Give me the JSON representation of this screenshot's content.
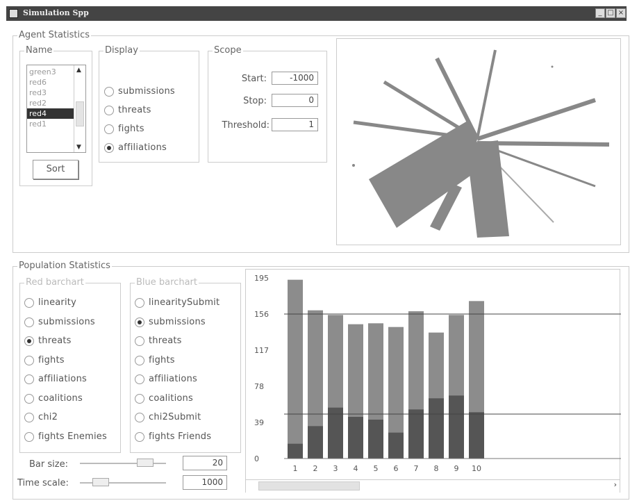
{
  "window": {
    "title": "Simulation Spp"
  },
  "agent_statistics": {
    "title": "Agent Statistics",
    "name_group": {
      "legend": "Name",
      "items": [
        "green3",
        "red6",
        "red3",
        "red2",
        "red4",
        "red1"
      ],
      "selected_index": 4,
      "sort_label": "Sort"
    },
    "display_group": {
      "legend": "Display",
      "options": [
        "submissions",
        "threats",
        "fights",
        "affiliations"
      ],
      "selected_index": 3
    },
    "scope_group": {
      "legend": "Scope",
      "start_label": "Start:",
      "start_value": "-1000",
      "stop_label": "Stop:",
      "stop_value": "0",
      "threshold_label": "Threshold:",
      "threshold_value": "1"
    }
  },
  "population_statistics": {
    "title": "Population Statistics",
    "red_barchart": {
      "legend": "Red barchart",
      "options": [
        "linearity",
        "submissions",
        "threats",
        "fights",
        "affiliations",
        "coalitions",
        "chi2",
        "fights Enemies"
      ],
      "selected_index": 2
    },
    "blue_barchart": {
      "legend": "Blue barchart",
      "options": [
        "linearitySubmit",
        "submissions",
        "threats",
        "fights",
        "affiliations",
        "coalitions",
        "chi2Submit",
        "fights Friends"
      ],
      "selected_index": 1
    },
    "bar_size": {
      "label": "Bar size:",
      "value": "20",
      "slider_fraction": 0.82
    },
    "time_scale": {
      "label": "Time scale:",
      "value": "1000",
      "slider_fraction": 0.18
    },
    "scroll": {
      "thumb_fraction": 0.28,
      "arrow": "›"
    }
  },
  "chart_data": {
    "type": "bar",
    "categories": [
      "1",
      "2",
      "3",
      "4",
      "5",
      "6",
      "7",
      "8",
      "9",
      "10"
    ],
    "series": [
      {
        "values": [
          193,
          160,
          155,
          145,
          146,
          142,
          159,
          136,
          155,
          170
        ],
        "color": "#8c8c8c"
      },
      {
        "values": [
          16,
          35,
          55,
          45,
          42,
          28,
          53,
          65,
          68,
          50
        ],
        "color": "#555555"
      }
    ],
    "ylim": [
      0,
      195
    ],
    "yticks": [
      "0",
      "39",
      "78",
      "117",
      "156",
      "195"
    ],
    "reference_lines": [
      156,
      48
    ]
  }
}
